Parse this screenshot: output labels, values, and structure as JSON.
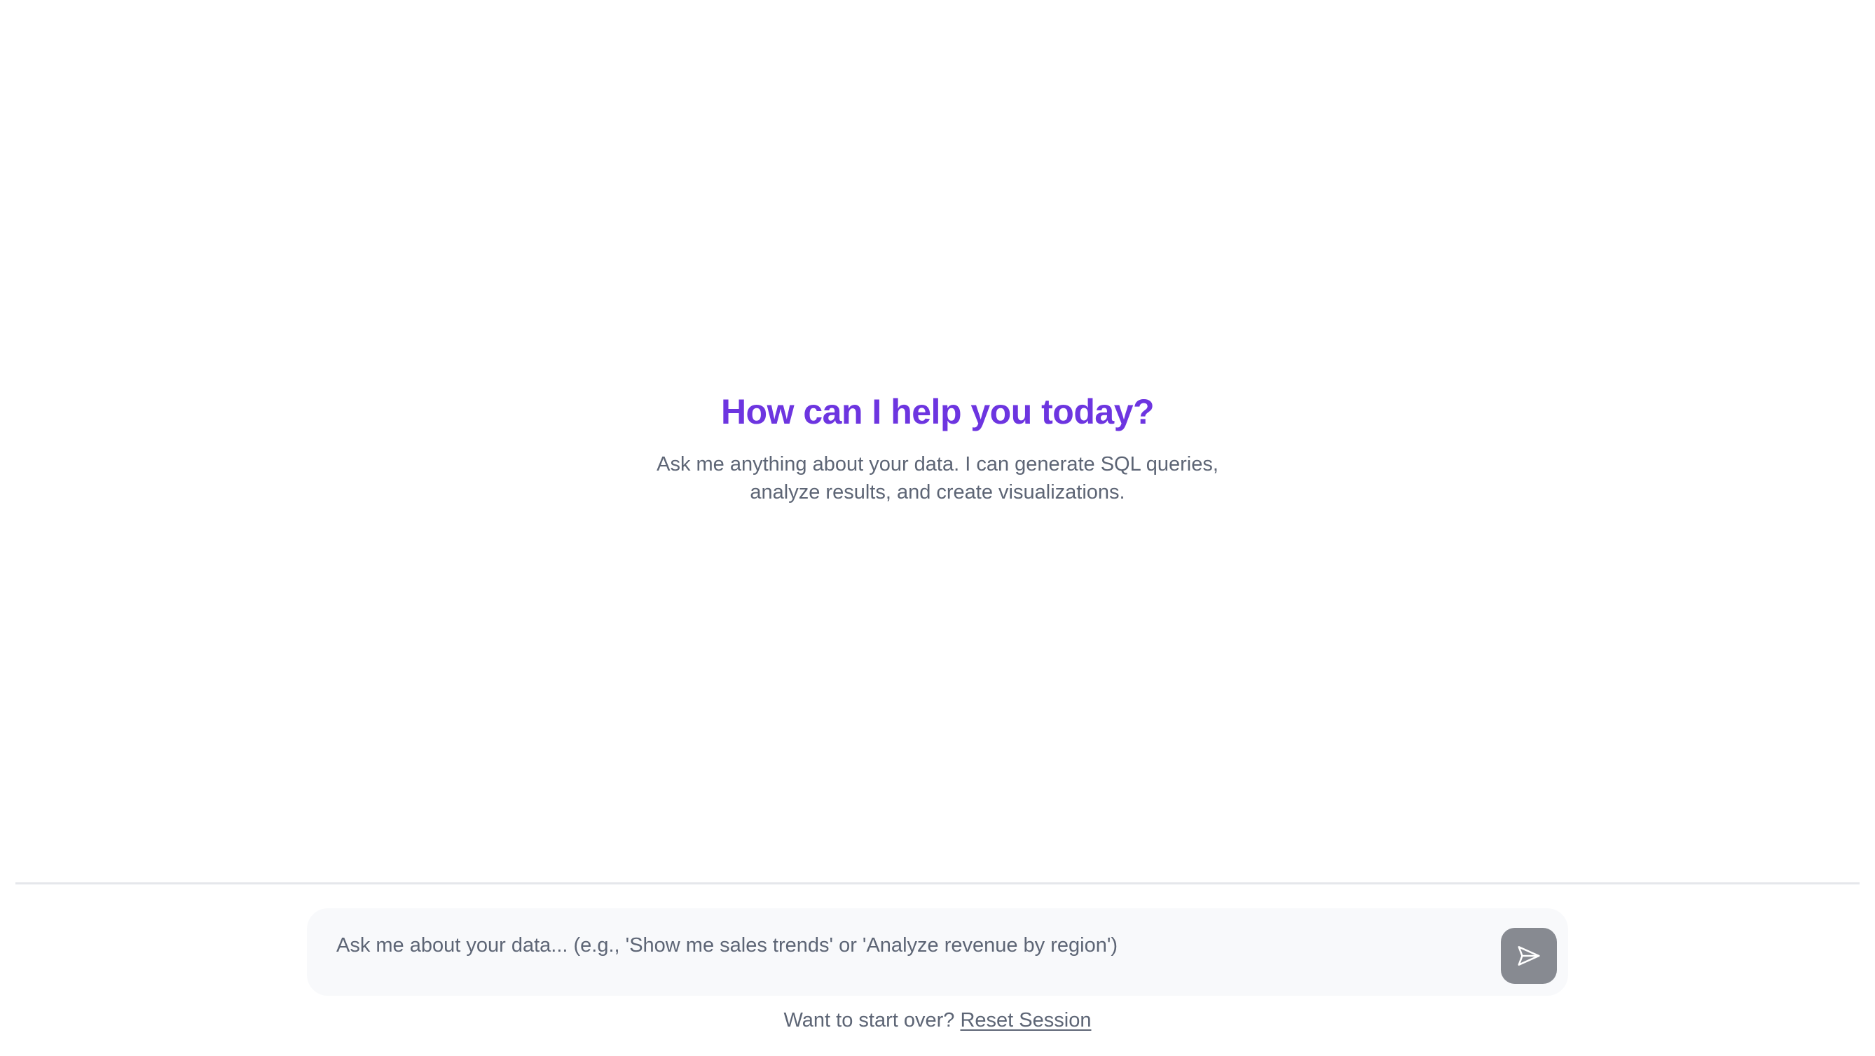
{
  "welcome": {
    "title": "How can I help you today?",
    "subtitle": "Ask me anything about your data. I can generate SQL queries, analyze results, and create visualizations."
  },
  "composer": {
    "placeholder": "Ask me about your data... (e.g., 'Show me sales trends' or 'Analyze revenue by region')",
    "value": "",
    "send_icon": "send-icon"
  },
  "footer": {
    "prompt": "Want to start over?",
    "reset_label": "Reset Session"
  },
  "colors": {
    "accent": "#6d35e0",
    "muted_text": "#5d6575",
    "send_button": "#878a91",
    "composer_bg": "#f8f9fb",
    "divider": "#e5e7eb"
  }
}
